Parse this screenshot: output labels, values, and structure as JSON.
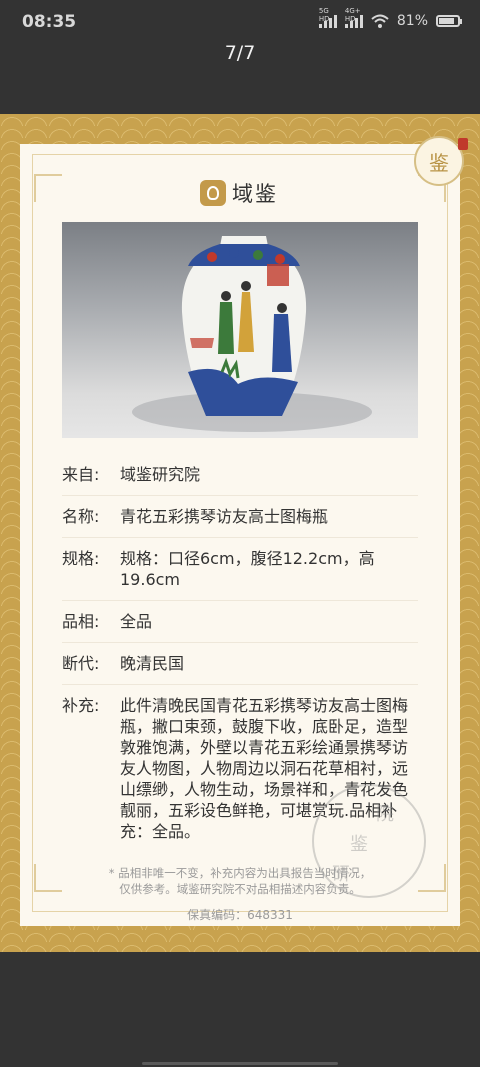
{
  "status_bar": {
    "time": "08:35",
    "net1": "5G HD",
    "net2": "4G+ HD",
    "battery": "81%",
    "battery_level": 0.81
  },
  "viewer": {
    "counter": "7/7"
  },
  "card": {
    "logo_text": "域鉴",
    "corner_seal": "鉴",
    "rows": [
      {
        "label": "来自:",
        "value": "域鉴研究院"
      },
      {
        "label": "名称:",
        "value": "青花五彩携琴访友高士图梅瓶"
      },
      {
        "label": "规格:",
        "value": "规格：口径6cm，腹径12.2cm，高19.6cm"
      },
      {
        "label": "品相:",
        "value": "全品"
      },
      {
        "label": "断代:",
        "value": "晚清民国"
      },
      {
        "label": "补充:",
        "value": "此件清晚民国青花五彩携琴访友高士图梅瓶，撇口束颈，鼓腹下收，底卧足，造型敦雅饱满，外壁以青花五彩绘通景携琴访友人物图，人物周边以洞石花草相衬，远山缥缈，人物生动，场景祥和，青花发色靓丽，五彩设色鲜艳，可堪赏玩.品相补充：全品。"
      }
    ],
    "disclaimer_line1": "* 品相非唯一不变，补充内容为出具报告当时情况，",
    "disclaimer_line2": "仅供参考。域鉴研究院不对品相描述内容负责。",
    "code_label": "保真编码：",
    "code_value": "648331"
  }
}
